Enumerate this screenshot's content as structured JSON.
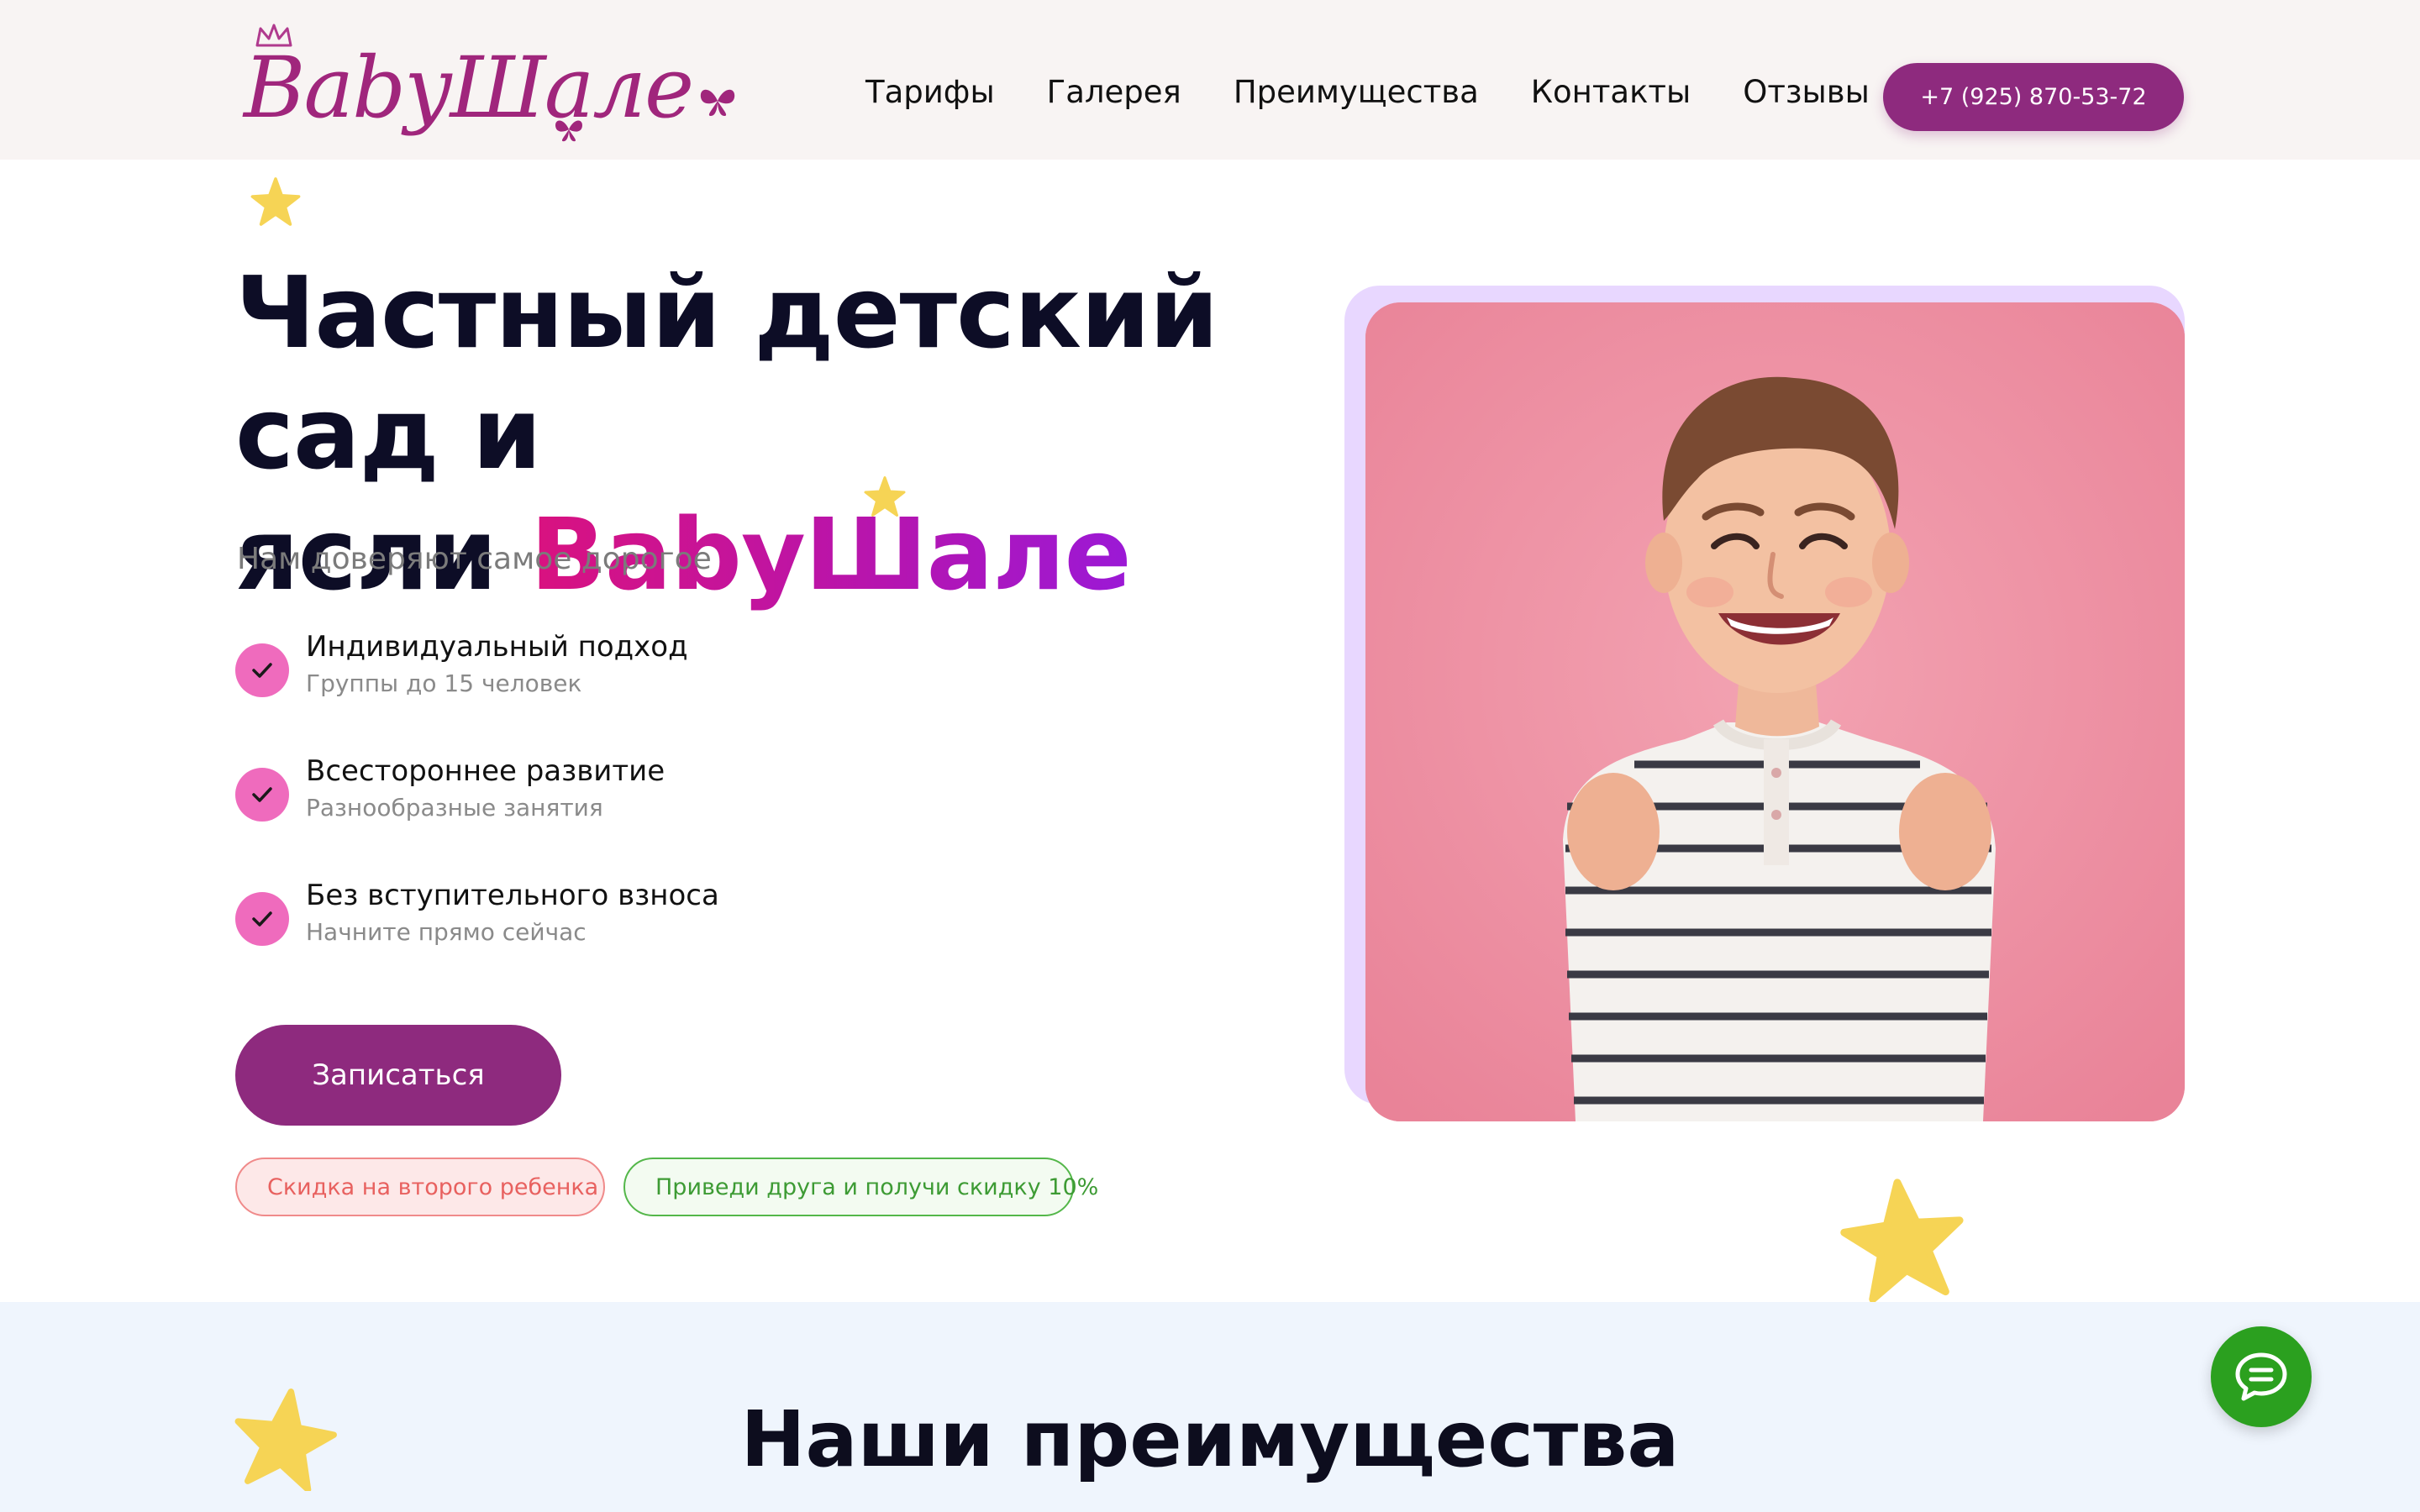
{
  "header": {
    "logo_text": "BabyШале",
    "nav": [
      "Тарифы",
      "Галерея",
      "Преимущества",
      "Контакты",
      "Отзывы"
    ],
    "phone": "+7 (925) 870-53-72"
  },
  "hero": {
    "title_line1": "Частный детский сад и",
    "title_line2_prefix": "ясли ",
    "title_brand": "BabyШале",
    "subtitle": "Нам доверяют самое дорогое",
    "features": [
      {
        "title": "Индивидуальный подход",
        "subtitle": "Группы до 15 человек"
      },
      {
        "title": "Всестороннее развитие",
        "subtitle": "Разнообразные занятия"
      },
      {
        "title": "Без вступительного взноса",
        "subtitle": "Начните прямо сейчас"
      }
    ],
    "cta_label": "Записаться",
    "badges": [
      {
        "icon": "gift-icon",
        "text": "Скидка на второго ребенка"
      },
      {
        "icon": "people-icon",
        "text": "Приведи друга и получи скидку 10%"
      }
    ]
  },
  "section2": {
    "title": "Наши преимущества"
  },
  "colors": {
    "brand_purple": "#8e2a7e",
    "accent_pink": "#ef6bbd",
    "chat_green": "#2ba01f",
    "star_yellow": "#f6d455"
  }
}
